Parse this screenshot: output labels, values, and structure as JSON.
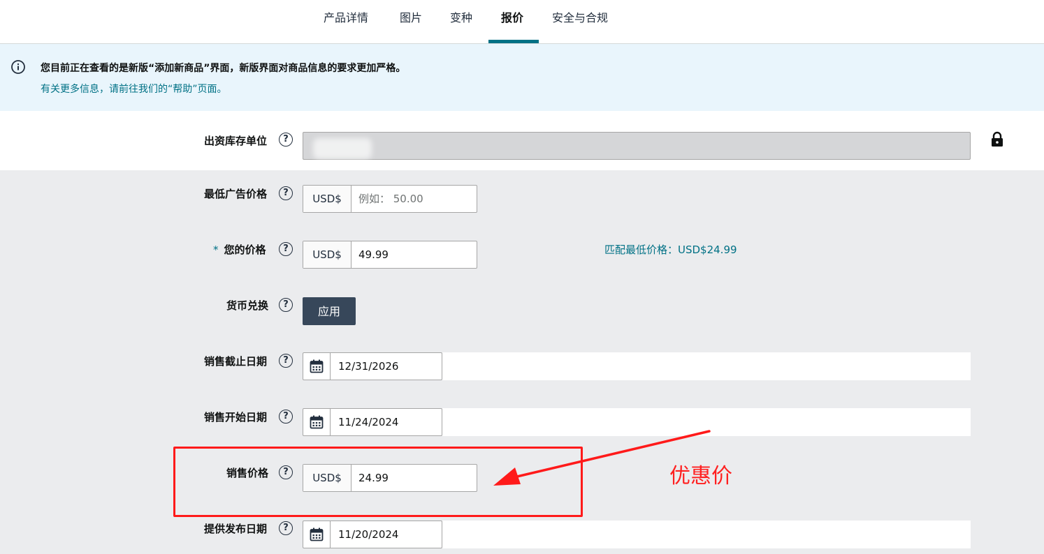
{
  "tabs": [
    {
      "label": "产品详情"
    },
    {
      "label": "图片"
    },
    {
      "label": "变种"
    },
    {
      "label": "报价",
      "active": true
    },
    {
      "label": "安全与合规"
    }
  ],
  "banner": {
    "message": "您目前正在查看的是新版“添加新商品”界面，新版界面对商品信息的要求更加严格。",
    "link": "有关更多信息，请前往我们的“帮助”页面。"
  },
  "help_glyph": "?",
  "fields": {
    "sku": {
      "label": "出资库存单位"
    },
    "map_price": {
      "label": "最低广告价格",
      "currency": "USD$",
      "placeholder": "例如： 50.00",
      "value": ""
    },
    "your_price": {
      "label": "您的价格",
      "required_mark": "*",
      "currency": "USD$",
      "value": "49.99"
    },
    "match_lowest": "匹配最低价格：USD$24.99",
    "currency_conversion": {
      "label": "货币兑换",
      "button": "应用"
    },
    "sale_end_date": {
      "label": "销售截止日期",
      "value": "12/31/2026"
    },
    "sale_start_date": {
      "label": "销售开始日期",
      "value": "11/24/2024"
    },
    "sale_price": {
      "label": "销售价格",
      "currency": "USD$",
      "value": "24.99"
    },
    "release_date": {
      "label": "提供发布日期",
      "value": "11/20/2024"
    }
  },
  "annotation": {
    "text": "优惠价",
    "color": "#ff2020"
  },
  "colors": {
    "accent": "#007185",
    "banner_bg": "#e9f5fc",
    "button_bg": "#37475a",
    "form_bg": "#ebecee"
  }
}
